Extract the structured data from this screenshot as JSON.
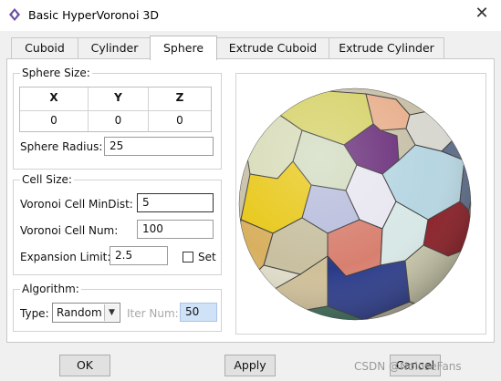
{
  "window": {
    "title": "Basic HyperVoronoi 3D"
  },
  "tabs": [
    {
      "label": "Cuboid"
    },
    {
      "label": "Cylinder"
    },
    {
      "label": "Sphere"
    },
    {
      "label": "Extrude Cuboid"
    },
    {
      "label": "Extrude Cylinder"
    }
  ],
  "active_tab": "Sphere",
  "sphere_size": {
    "legend": "Sphere Size:",
    "headers": [
      "X",
      "Y",
      "Z"
    ],
    "values": [
      "0",
      "0",
      "0"
    ],
    "radius_label": "Sphere Radius:",
    "radius_value": "25"
  },
  "cell_size": {
    "legend": "Cell Size:",
    "min_dist_label": "Voronoi Cell MinDist:",
    "min_dist_value": "5",
    "cell_num_label": "Voronoi Cell Num:",
    "cell_num_value": "100",
    "expansion_label": "Expansion Limit:",
    "expansion_value": "2.5",
    "set_label": "Set",
    "set_checked": false
  },
  "algorithm": {
    "legend": "Algorithm:",
    "type_label": "Type:",
    "type_value": "Random",
    "iter_label": "Iter Num:",
    "iter_value": "50"
  },
  "buttons": {
    "ok": "OK",
    "apply": "Apply",
    "cancel": "Cancel"
  },
  "watermark": "CSDN @NoloseFans"
}
